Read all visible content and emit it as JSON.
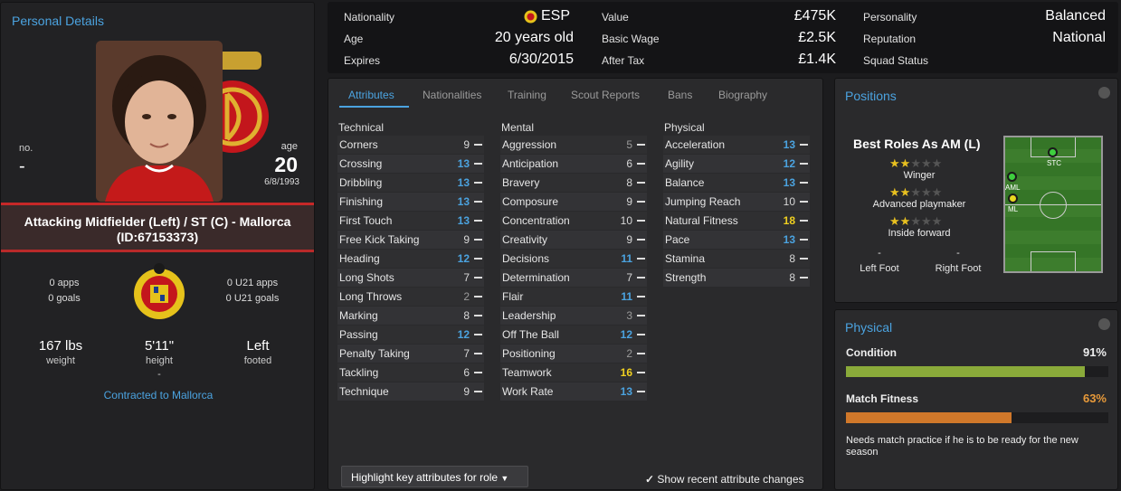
{
  "player": {
    "panel_title": "Personal Details",
    "no_label": "no.",
    "no_value": "-",
    "age_label": "age",
    "age_value": "20",
    "dob": "6/8/1993",
    "position_club": "Attacking Midfielder (Left) / ST (C) - Mallorca",
    "id": "(ID:67153373)",
    "apps": "0 apps",
    "goals": "0 goals",
    "u21_apps": "0 U21 apps",
    "u21_goals": "0 U21 goals",
    "weight_value": "167 lbs",
    "weight_label": "weight",
    "height_value": "5'11\"",
    "height_label": "height",
    "foot_value": "Left",
    "foot_label": "footed",
    "dash": "-",
    "contract": "Contracted to Mallorca"
  },
  "info": {
    "nationality_label": "Nationality",
    "nationality_value": "ESP",
    "age_label": "Age",
    "age_value": "20 years old",
    "expires_label": "Expires",
    "expires_value": "6/30/2015",
    "value_label": "Value",
    "value_value": "£475K",
    "wage_label": "Basic Wage",
    "wage_value": "£2.5K",
    "aftertax_label": "After Tax",
    "aftertax_value": "£1.4K",
    "personality_label": "Personality",
    "personality_value": "Balanced",
    "reputation_label": "Reputation",
    "reputation_value": "National",
    "squad_label": "Squad Status"
  },
  "tabs": [
    "Attributes",
    "Nationalities",
    "Training",
    "Scout Reports",
    "Bans",
    "Biography"
  ],
  "attributes": {
    "technical_title": "Technical",
    "mental_title": "Mental",
    "physical_title": "Physical",
    "technical": [
      [
        "Corners",
        "9"
      ],
      [
        "Crossing",
        "13"
      ],
      [
        "Dribbling",
        "13"
      ],
      [
        "Finishing",
        "13"
      ],
      [
        "First Touch",
        "13"
      ],
      [
        "Free Kick Taking",
        "9"
      ],
      [
        "Heading",
        "12"
      ],
      [
        "Long Shots",
        "7"
      ],
      [
        "Long Throws",
        "2"
      ],
      [
        "Marking",
        "8"
      ],
      [
        "Passing",
        "12"
      ],
      [
        "Penalty Taking",
        "7"
      ],
      [
        "Tackling",
        "6"
      ],
      [
        "Technique",
        "9"
      ]
    ],
    "mental": [
      [
        "Aggression",
        "5"
      ],
      [
        "Anticipation",
        "6"
      ],
      [
        "Bravery",
        "8"
      ],
      [
        "Composure",
        "9"
      ],
      [
        "Concentration",
        "10"
      ],
      [
        "Creativity",
        "9"
      ],
      [
        "Decisions",
        "11"
      ],
      [
        "Determination",
        "7"
      ],
      [
        "Flair",
        "11"
      ],
      [
        "Leadership",
        "3"
      ],
      [
        "Off The Ball",
        "12"
      ],
      [
        "Positioning",
        "2"
      ],
      [
        "Teamwork",
        "16"
      ],
      [
        "Work Rate",
        "13"
      ]
    ],
    "physical": [
      [
        "Acceleration",
        "13"
      ],
      [
        "Agility",
        "12"
      ],
      [
        "Balance",
        "13"
      ],
      [
        "Jumping Reach",
        "10"
      ],
      [
        "Natural Fitness",
        "18"
      ],
      [
        "Pace",
        "13"
      ],
      [
        "Stamina",
        "8"
      ],
      [
        "Strength",
        "8"
      ]
    ],
    "highlight_button": "Highlight key attributes for role",
    "show_changes": "Show recent attribute changes"
  },
  "positions": {
    "title": "Positions",
    "best_roles": "Best Roles As AM (L)",
    "roles": [
      {
        "name": "Winger",
        "stars": 2
      },
      {
        "name": "Advanced playmaker",
        "stars": 2
      },
      {
        "name": "Inside forward",
        "stars": 2
      }
    ],
    "left_foot_value": "-",
    "left_foot_label": "Left Foot",
    "right_foot_value": "-",
    "right_foot_label": "Right Foot",
    "pitch_labels": [
      "STC",
      "AML",
      "ML"
    ]
  },
  "physical": {
    "title": "Physical",
    "condition_label": "Condition",
    "condition_value": "91%",
    "condition_fraction": 0.91,
    "fitness_label": "Match Fitness",
    "fitness_value": "63%",
    "fitness_fraction": 0.63,
    "note": "Needs match practice if he is to be ready for the new season"
  },
  "colors": {
    "accent": "#4ba3e0",
    "high_value": "#4ba3e0",
    "top_value": "#f0d020",
    "normal_value": "#d8d8d8",
    "low_value": "#9a9a9a",
    "condition_bar": "#8aaa3a",
    "fitness_bar": "#d0782a"
  }
}
